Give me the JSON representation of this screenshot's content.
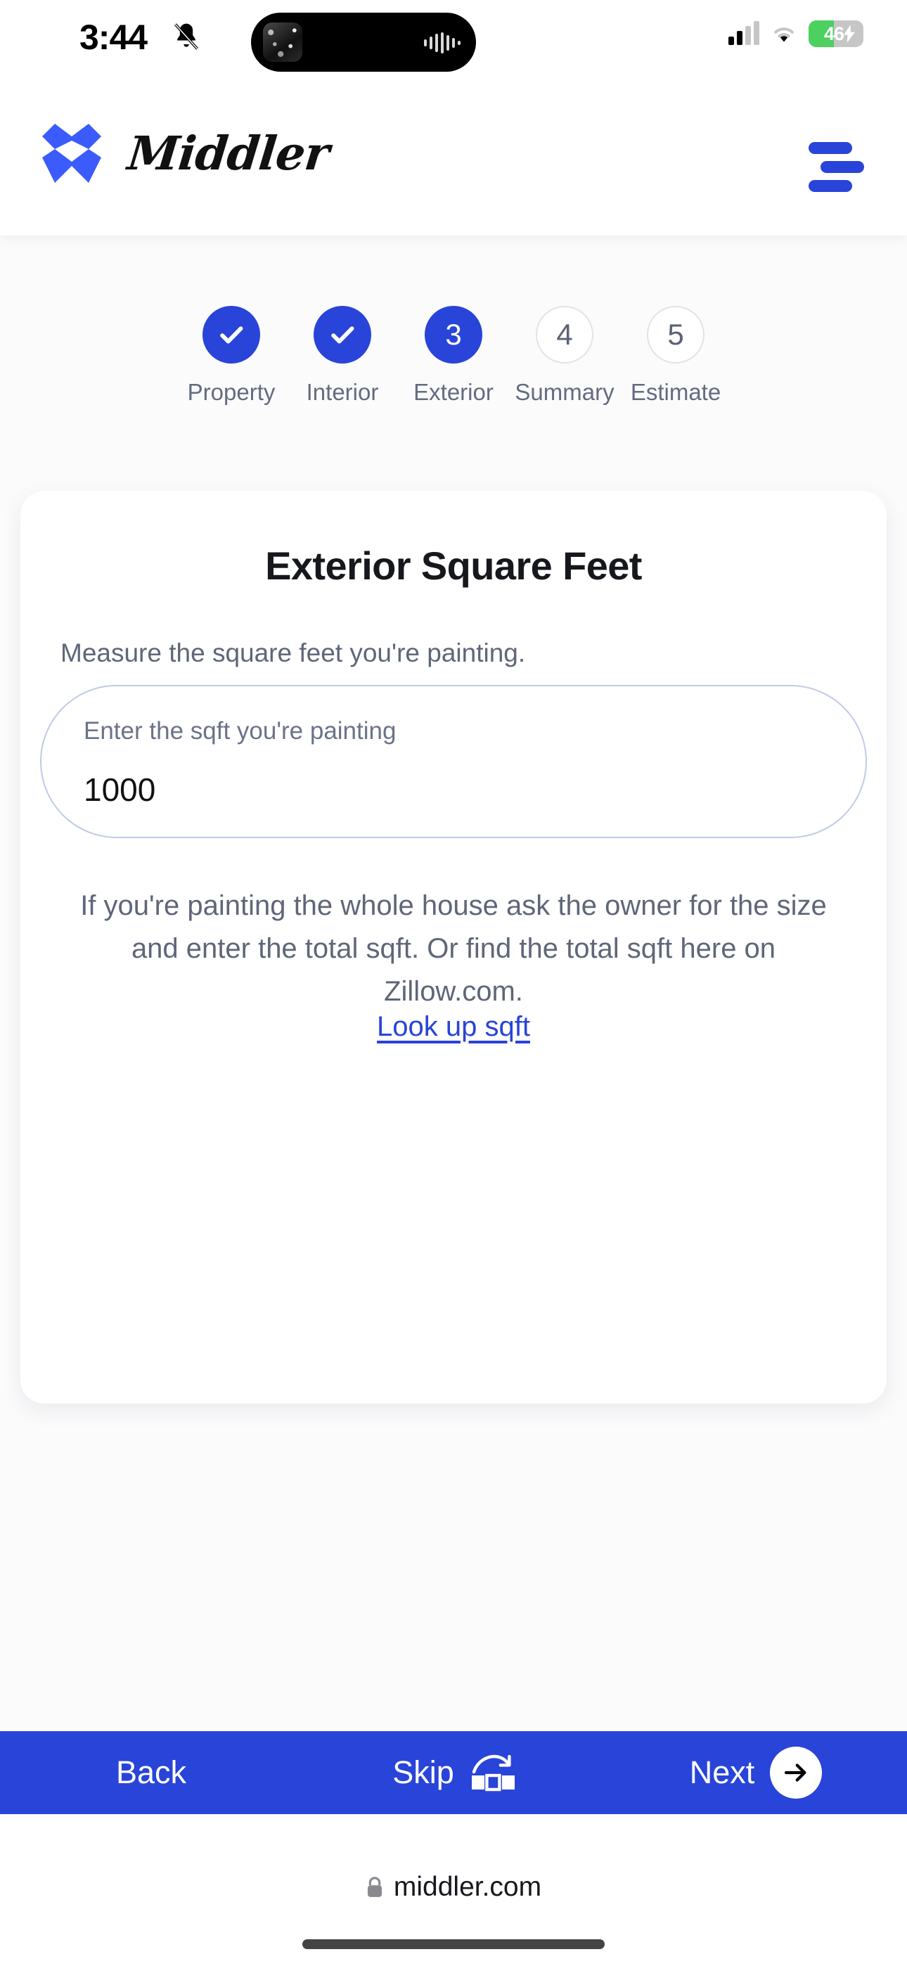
{
  "status_bar": {
    "time": "3:44",
    "silent_icon": "bell-slash-icon",
    "cellular_icon": "cellular-bars-icon",
    "wifi_icon": "wifi-icon",
    "battery_percent": "46",
    "battery_charging": true,
    "battery_color": "#4cd060"
  },
  "header": {
    "brand_name": "Middler",
    "logo_icon": "middler-logo-icon",
    "menu_icon": "hamburger-menu-icon",
    "brand_color": "#2944d8"
  },
  "stepper": {
    "steps": [
      {
        "number": "1",
        "label": "Property",
        "state": "done"
      },
      {
        "number": "2",
        "label": "Interior",
        "state": "done"
      },
      {
        "number": "3",
        "label": "Exterior",
        "state": "current"
      },
      {
        "number": "4",
        "label": "Summary",
        "state": "todo"
      },
      {
        "number": "5",
        "label": "Estimate",
        "state": "todo"
      }
    ]
  },
  "card": {
    "title": "Exterior Square Feet",
    "subtitle": "Measure the square feet you're painting.",
    "input": {
      "label": "Enter the sqft you're painting",
      "value": "1000",
      "placeholder": "Enter the sqft you're painting"
    },
    "helper_text": "If you're painting the whole house ask the owner for the size and enter the total sqft. Or find the total sqft here on Zillow.com.",
    "link_label": "Look up sqft"
  },
  "bottom_bar": {
    "back_label": "Back",
    "skip_label": "Skip",
    "skip_icon": "skip-over-icon",
    "next_label": "Next",
    "next_icon": "arrow-right-icon",
    "background_color": "#2944d8"
  },
  "browser": {
    "lock_icon": "lock-icon",
    "url": "middler.com"
  }
}
